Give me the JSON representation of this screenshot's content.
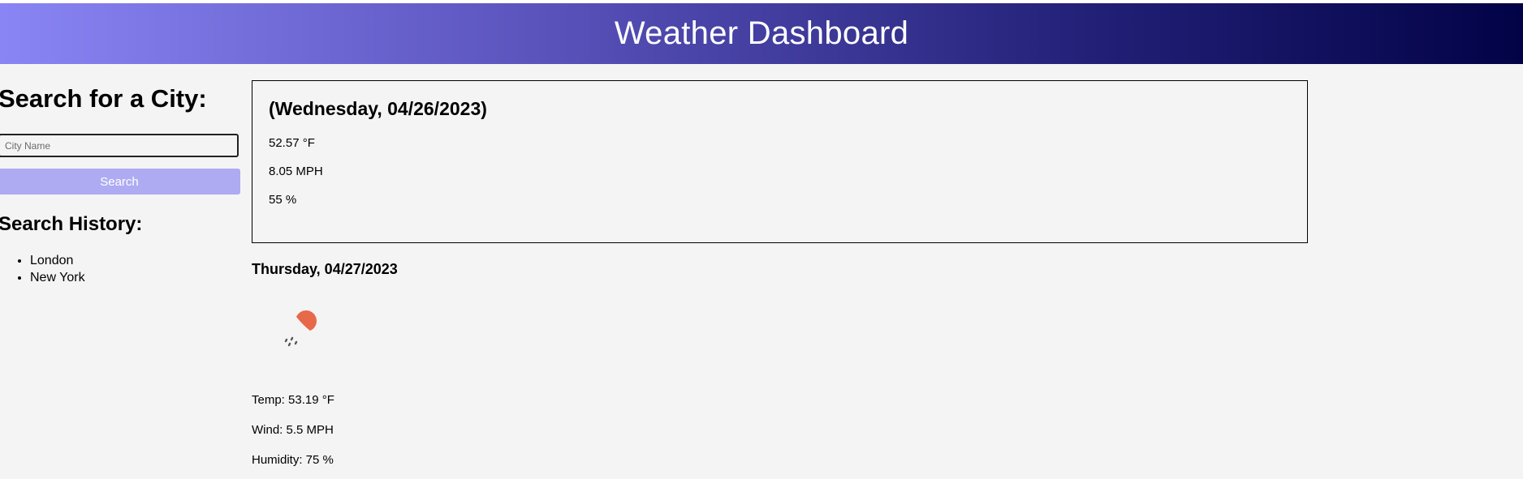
{
  "header": {
    "title": "Weather Dashboard"
  },
  "sidebar": {
    "search_heading": "Search for a City:",
    "city_input": {
      "placeholder": "City Name",
      "value": ""
    },
    "search_button_label": "Search",
    "history_heading": "Search History:",
    "history": [
      "London",
      "New York"
    ]
  },
  "current": {
    "date": "(Wednesday, 04/26/2023)",
    "temp": "52.57 °F",
    "wind": "8.05 MPH",
    "humidity": "55 %"
  },
  "forecast": [
    {
      "date": "Thursday, 04/27/2023",
      "icon": "rain-cloud-sun-icon",
      "temp": "Temp: 53.19 °F",
      "wind": "Wind: 5.5 MPH",
      "humidity": "Humidity: 75 %"
    }
  ],
  "colors": {
    "header_gradient_start": "#8a85f5",
    "header_gradient_end": "#020247",
    "search_button": "#aeabf2",
    "sun": "#e8684a",
    "background": "#f4f4f4"
  }
}
